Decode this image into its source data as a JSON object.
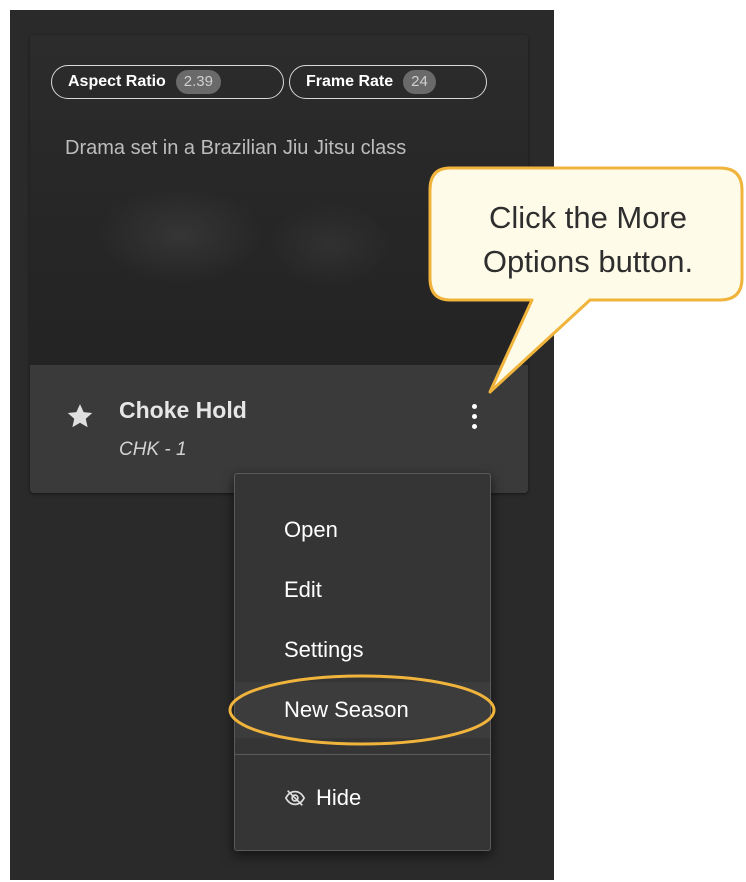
{
  "project_card": {
    "tags": [
      {
        "label": "Aspect Ratio",
        "value": "2.39"
      },
      {
        "label": "Frame Rate",
        "value": "24"
      }
    ],
    "description": "Drama set in a Brazilian Jiu Jitsu class",
    "title": "Choke Hold",
    "code": "CHK - 1",
    "favorite_icon": "star-icon",
    "more_options_icon": "more-vertical-icon"
  },
  "context_menu": {
    "items": [
      {
        "label": "Open"
      },
      {
        "label": "Edit"
      },
      {
        "label": "Settings"
      },
      {
        "label": "New Season"
      }
    ],
    "hide": {
      "label": "Hide",
      "icon": "eye-slash-icon"
    }
  },
  "callout": {
    "text": "Click the More Options button."
  },
  "colors": {
    "panel_background": "#2a2a2a",
    "callout_fill": "#fffbe9",
    "callout_border": "#f0b43c",
    "highlight_ring": "#f0b43c"
  }
}
